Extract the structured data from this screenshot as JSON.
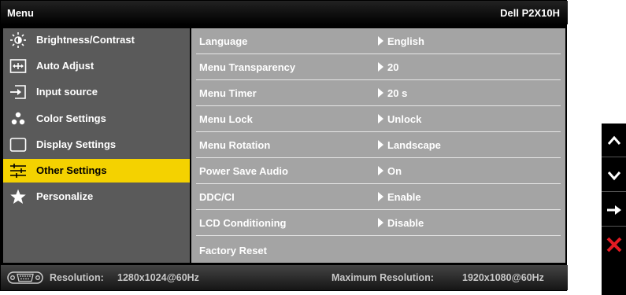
{
  "header": {
    "title": "Menu",
    "model": "Dell P2X10H"
  },
  "sidebar": {
    "items": [
      {
        "label": "Brightness/Contrast",
        "icon": "brightness-icon"
      },
      {
        "label": "Auto Adjust",
        "icon": "auto-adjust-icon"
      },
      {
        "label": "Input source",
        "icon": "input-source-icon"
      },
      {
        "label": "Color Settings",
        "icon": "color-settings-icon"
      },
      {
        "label": "Display Settings",
        "icon": "display-settings-icon"
      },
      {
        "label": "Other Settings",
        "icon": "other-settings-icon",
        "selected": true
      },
      {
        "label": "Personalize",
        "icon": "star-icon"
      }
    ]
  },
  "options": [
    {
      "name": "Language",
      "value": "English"
    },
    {
      "name": "Menu Transparency",
      "value": "20"
    },
    {
      "name": "Menu Timer",
      "value": "20 s"
    },
    {
      "name": "Menu Lock",
      "value": "Unlock"
    },
    {
      "name": "Menu Rotation",
      "value": "Landscape"
    },
    {
      "name": "Power Save Audio",
      "value": "On"
    },
    {
      "name": "DDC/CI",
      "value": "Enable"
    },
    {
      "name": "LCD Conditioning",
      "value": "Disable"
    },
    {
      "name": "Factory Reset",
      "value": ""
    }
  ],
  "status": {
    "resolution_label": "Resolution:",
    "resolution_value": "1280x1024@60Hz",
    "max_label": "Maximum Resolution:",
    "max_value": "1920x1080@60Hz"
  },
  "side_buttons": [
    {
      "icon": "up-arrow-icon"
    },
    {
      "icon": "down-arrow-icon"
    },
    {
      "icon": "enter-arrow-icon"
    },
    {
      "icon": "exit-x-icon"
    }
  ],
  "colors": {
    "selected_bg": "#f4d200",
    "left_panel_bg": "#5a5a5a",
    "right_panel_bg": "#a4a4a4",
    "exit_red": "#e31b23"
  }
}
